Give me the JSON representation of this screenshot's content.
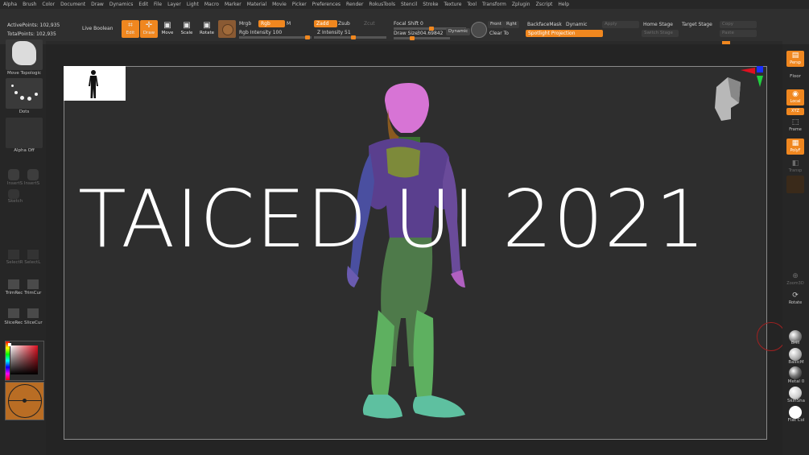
{
  "menu": [
    "Alpha",
    "Brush",
    "Color",
    "Document",
    "Draw",
    "Dynamics",
    "Edit",
    "File",
    "Layer",
    "Light",
    "Macro",
    "Marker",
    "Material",
    "Movie",
    "Picker",
    "Preferences",
    "Render",
    "RokusTools",
    "Stencil",
    "Stroke",
    "Texture",
    "Tool",
    "Transform",
    "Zplugin",
    "Zscript",
    "Help"
  ],
  "stats": {
    "active": "ActivePoints: 102,935",
    "total": "TotalPoints: 102,935"
  },
  "toolbar": {
    "live_boolean": "Live Boolean",
    "edit": "Edit",
    "draw": "Draw",
    "move": "Move",
    "scale": "Scale",
    "rotate": "Rotate",
    "mrgb": "Mrgb",
    "rgb": "Rgb",
    "m": "M",
    "rgb_intensity": "Rgb Intensity 100",
    "zadd": "Zadd",
    "zsub": "Zsub",
    "zcut": "Zcut",
    "z_intensity": "Z Intensity 51",
    "focal_shift": "Focal Shift 0",
    "draw_size_label": "Draw Size",
    "draw_size_value": "304.69842",
    "dynamic": "Dynamic",
    "front": "Front",
    "right": "Rght",
    "clear_to": "Clear To",
    "backface": "BackfaceMask",
    "dynamic2": "Dynamic",
    "apply": "Apply",
    "spotlight": "Spotlight Projection",
    "home_stage": "Home Stage",
    "target_stage": "Target Stage",
    "copy": "Copy",
    "switch_stage": "Switch Stage",
    "paste": "Paste"
  },
  "left_shelf": {
    "brush_label": "Move Topologic",
    "stroke_label": "Dots",
    "alpha_label": "Alpha Off",
    "dim1": "InsertS InsertS",
    "dim2": "Sketch",
    "dim3": "SelectR SelectL",
    "trim": "TrimRec TrimCur",
    "slice": "SliceRec SliceCur"
  },
  "right_shelf": {
    "persp": "Persp",
    "floor": "Floor",
    "local": "Local",
    "xyz": "XYZ",
    "frame": "Frame",
    "polyf": "PolyF",
    "transp": "Transp",
    "zoom3d": "Zoom3D",
    "rotate": "Rotate",
    "mat1": "Brill",
    "mat2": "BasicM",
    "mat3": "Metal 0",
    "mat4": "SkinSha",
    "mat5": "Flat Col"
  },
  "overlay_title": "TAICED UI 2021",
  "colors": {
    "accent": "#f0871f",
    "canvas": "#2e2e2e"
  }
}
